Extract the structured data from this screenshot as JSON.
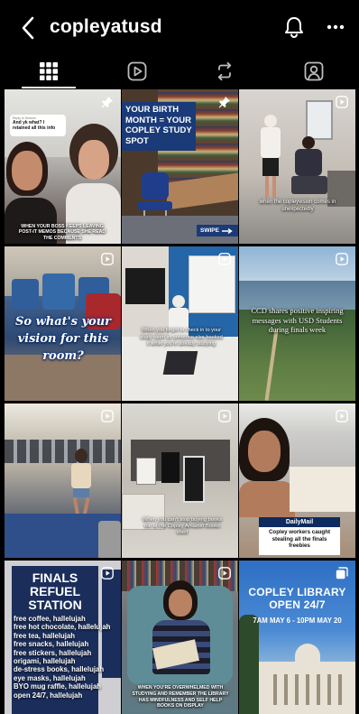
{
  "header": {
    "username": "copleyatusd"
  },
  "tabs": [
    {
      "name": "grid-tab",
      "icon": "grid-icon",
      "active": true
    },
    {
      "name": "reels-tab",
      "icon": "play-icon",
      "active": false
    },
    {
      "name": "reposts-tab",
      "icon": "repost-icon",
      "active": false
    },
    {
      "name": "tagged-tab",
      "icon": "tagged-person-icon",
      "active": false
    }
  ],
  "posts": {
    "p1": {
      "badge": "pin-icon",
      "reply_label": "Reply to Sneeze",
      "reply_text": "And yk what? I retained all this info",
      "caption": "WHEN YOUR BOSS KEEPS LEAVING POST-IT MEMOS BECAUSE SHE READ THE COMMENTS"
    },
    "p2": {
      "badge": "pin-icon",
      "headline": "YOUR BIRTH MONTH = YOUR COPLEY STUDY SPOT",
      "swipe": "SWIPE"
    },
    "p3": {
      "badge": "reel-icon",
      "caption": "when the copleyvision comes in unexpectedly"
    },
    "p4": {
      "badge": "reel-icon",
      "caption": "So what's your vision for this room?"
    },
    "p5": {
      "badge": "reel-icon",
      "caption": "When you forgot to check in to your study room so someone else booked it while you're already studying"
    },
    "p6": {
      "badge": "reel-icon",
      "caption": "CCD shares positive inspiring messages with USD Students during finals week"
    },
    "p7": {
      "badge": "reel-icon"
    },
    "p8": {
      "badge": "reel-icon",
      "caption": "When you can't stop buying books the at the Copley Amazon Books shelf"
    },
    "p9": {
      "badge": "reel-icon",
      "brand": "DailyMail",
      "headline": "Copley workers caught stealing all the finals freebies"
    },
    "p10": {
      "badge": "reel-icon",
      "title": "FINALS REFUEL STATION",
      "lines": [
        "free coffee, hallelujah",
        "free hot chocolate, hallelujah",
        "free tea, hallelujah",
        "free snacks, hallelujah",
        "free stickers, hallelujah",
        "origami, hallelujah",
        "de-stress books, hallelujah",
        "eye masks, hallelujah",
        "BYO mug raffle, hallelujah",
        "open 24/7, hallelujah"
      ]
    },
    "p11": {
      "badge": "reel-icon",
      "caption": "WHEN YOU'RE OVERWHELMED WITH STUDYING AND REMEMBER THE LIBRARY HAS MINDFULNESS AND SELF HELP BOOKS ON DISPLAY"
    },
    "p12": {
      "badge": "carousel-icon",
      "title": "COPLEY LIBRARY OPEN 24/7",
      "dates": "7AM MAY 6 - 10PM MAY 20"
    }
  }
}
